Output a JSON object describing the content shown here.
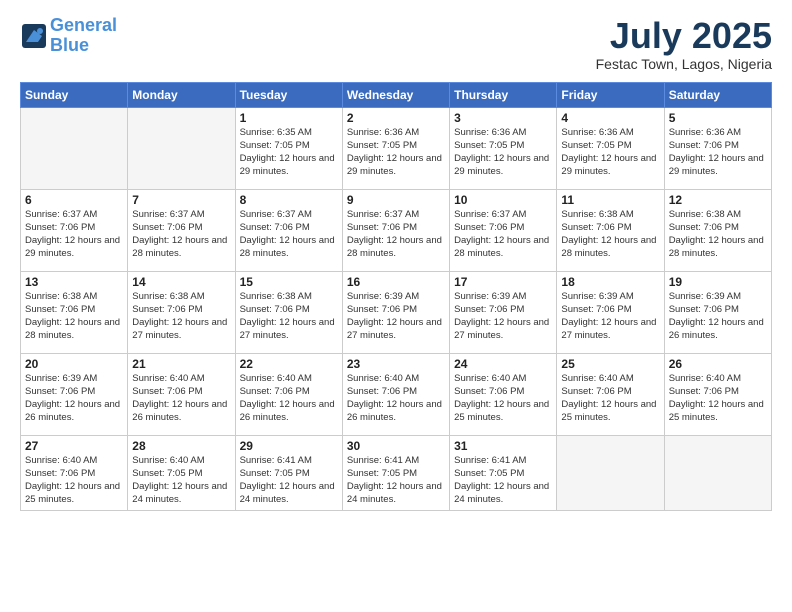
{
  "header": {
    "logo_line1": "General",
    "logo_line2": "Blue",
    "month_title": "July 2025",
    "location": "Festac Town, Lagos, Nigeria"
  },
  "weekdays": [
    "Sunday",
    "Monday",
    "Tuesday",
    "Wednesday",
    "Thursday",
    "Friday",
    "Saturday"
  ],
  "weeks": [
    [
      {
        "day": "",
        "empty": true
      },
      {
        "day": "",
        "empty": true
      },
      {
        "day": "1",
        "sunrise": "6:35 AM",
        "sunset": "7:05 PM",
        "daylight": "12 hours and 29 minutes."
      },
      {
        "day": "2",
        "sunrise": "6:36 AM",
        "sunset": "7:05 PM",
        "daylight": "12 hours and 29 minutes."
      },
      {
        "day": "3",
        "sunrise": "6:36 AM",
        "sunset": "7:05 PM",
        "daylight": "12 hours and 29 minutes."
      },
      {
        "day": "4",
        "sunrise": "6:36 AM",
        "sunset": "7:05 PM",
        "daylight": "12 hours and 29 minutes."
      },
      {
        "day": "5",
        "sunrise": "6:36 AM",
        "sunset": "7:06 PM",
        "daylight": "12 hours and 29 minutes."
      }
    ],
    [
      {
        "day": "6",
        "sunrise": "6:37 AM",
        "sunset": "7:06 PM",
        "daylight": "12 hours and 29 minutes."
      },
      {
        "day": "7",
        "sunrise": "6:37 AM",
        "sunset": "7:06 PM",
        "daylight": "12 hours and 28 minutes."
      },
      {
        "day": "8",
        "sunrise": "6:37 AM",
        "sunset": "7:06 PM",
        "daylight": "12 hours and 28 minutes."
      },
      {
        "day": "9",
        "sunrise": "6:37 AM",
        "sunset": "7:06 PM",
        "daylight": "12 hours and 28 minutes."
      },
      {
        "day": "10",
        "sunrise": "6:37 AM",
        "sunset": "7:06 PM",
        "daylight": "12 hours and 28 minutes."
      },
      {
        "day": "11",
        "sunrise": "6:38 AM",
        "sunset": "7:06 PM",
        "daylight": "12 hours and 28 minutes."
      },
      {
        "day": "12",
        "sunrise": "6:38 AM",
        "sunset": "7:06 PM",
        "daylight": "12 hours and 28 minutes."
      }
    ],
    [
      {
        "day": "13",
        "sunrise": "6:38 AM",
        "sunset": "7:06 PM",
        "daylight": "12 hours and 28 minutes."
      },
      {
        "day": "14",
        "sunrise": "6:38 AM",
        "sunset": "7:06 PM",
        "daylight": "12 hours and 27 minutes."
      },
      {
        "day": "15",
        "sunrise": "6:38 AM",
        "sunset": "7:06 PM",
        "daylight": "12 hours and 27 minutes."
      },
      {
        "day": "16",
        "sunrise": "6:39 AM",
        "sunset": "7:06 PM",
        "daylight": "12 hours and 27 minutes."
      },
      {
        "day": "17",
        "sunrise": "6:39 AM",
        "sunset": "7:06 PM",
        "daylight": "12 hours and 27 minutes."
      },
      {
        "day": "18",
        "sunrise": "6:39 AM",
        "sunset": "7:06 PM",
        "daylight": "12 hours and 27 minutes."
      },
      {
        "day": "19",
        "sunrise": "6:39 AM",
        "sunset": "7:06 PM",
        "daylight": "12 hours and 26 minutes."
      }
    ],
    [
      {
        "day": "20",
        "sunrise": "6:39 AM",
        "sunset": "7:06 PM",
        "daylight": "12 hours and 26 minutes."
      },
      {
        "day": "21",
        "sunrise": "6:40 AM",
        "sunset": "7:06 PM",
        "daylight": "12 hours and 26 minutes."
      },
      {
        "day": "22",
        "sunrise": "6:40 AM",
        "sunset": "7:06 PM",
        "daylight": "12 hours and 26 minutes."
      },
      {
        "day": "23",
        "sunrise": "6:40 AM",
        "sunset": "7:06 PM",
        "daylight": "12 hours and 26 minutes."
      },
      {
        "day": "24",
        "sunrise": "6:40 AM",
        "sunset": "7:06 PM",
        "daylight": "12 hours and 25 minutes."
      },
      {
        "day": "25",
        "sunrise": "6:40 AM",
        "sunset": "7:06 PM",
        "daylight": "12 hours and 25 minutes."
      },
      {
        "day": "26",
        "sunrise": "6:40 AM",
        "sunset": "7:06 PM",
        "daylight": "12 hours and 25 minutes."
      }
    ],
    [
      {
        "day": "27",
        "sunrise": "6:40 AM",
        "sunset": "7:06 PM",
        "daylight": "12 hours and 25 minutes."
      },
      {
        "day": "28",
        "sunrise": "6:40 AM",
        "sunset": "7:05 PM",
        "daylight": "12 hours and 24 minutes."
      },
      {
        "day": "29",
        "sunrise": "6:41 AM",
        "sunset": "7:05 PM",
        "daylight": "12 hours and 24 minutes."
      },
      {
        "day": "30",
        "sunrise": "6:41 AM",
        "sunset": "7:05 PM",
        "daylight": "12 hours and 24 minutes."
      },
      {
        "day": "31",
        "sunrise": "6:41 AM",
        "sunset": "7:05 PM",
        "daylight": "12 hours and 24 minutes."
      },
      {
        "day": "",
        "empty": true
      },
      {
        "day": "",
        "empty": true
      }
    ]
  ]
}
